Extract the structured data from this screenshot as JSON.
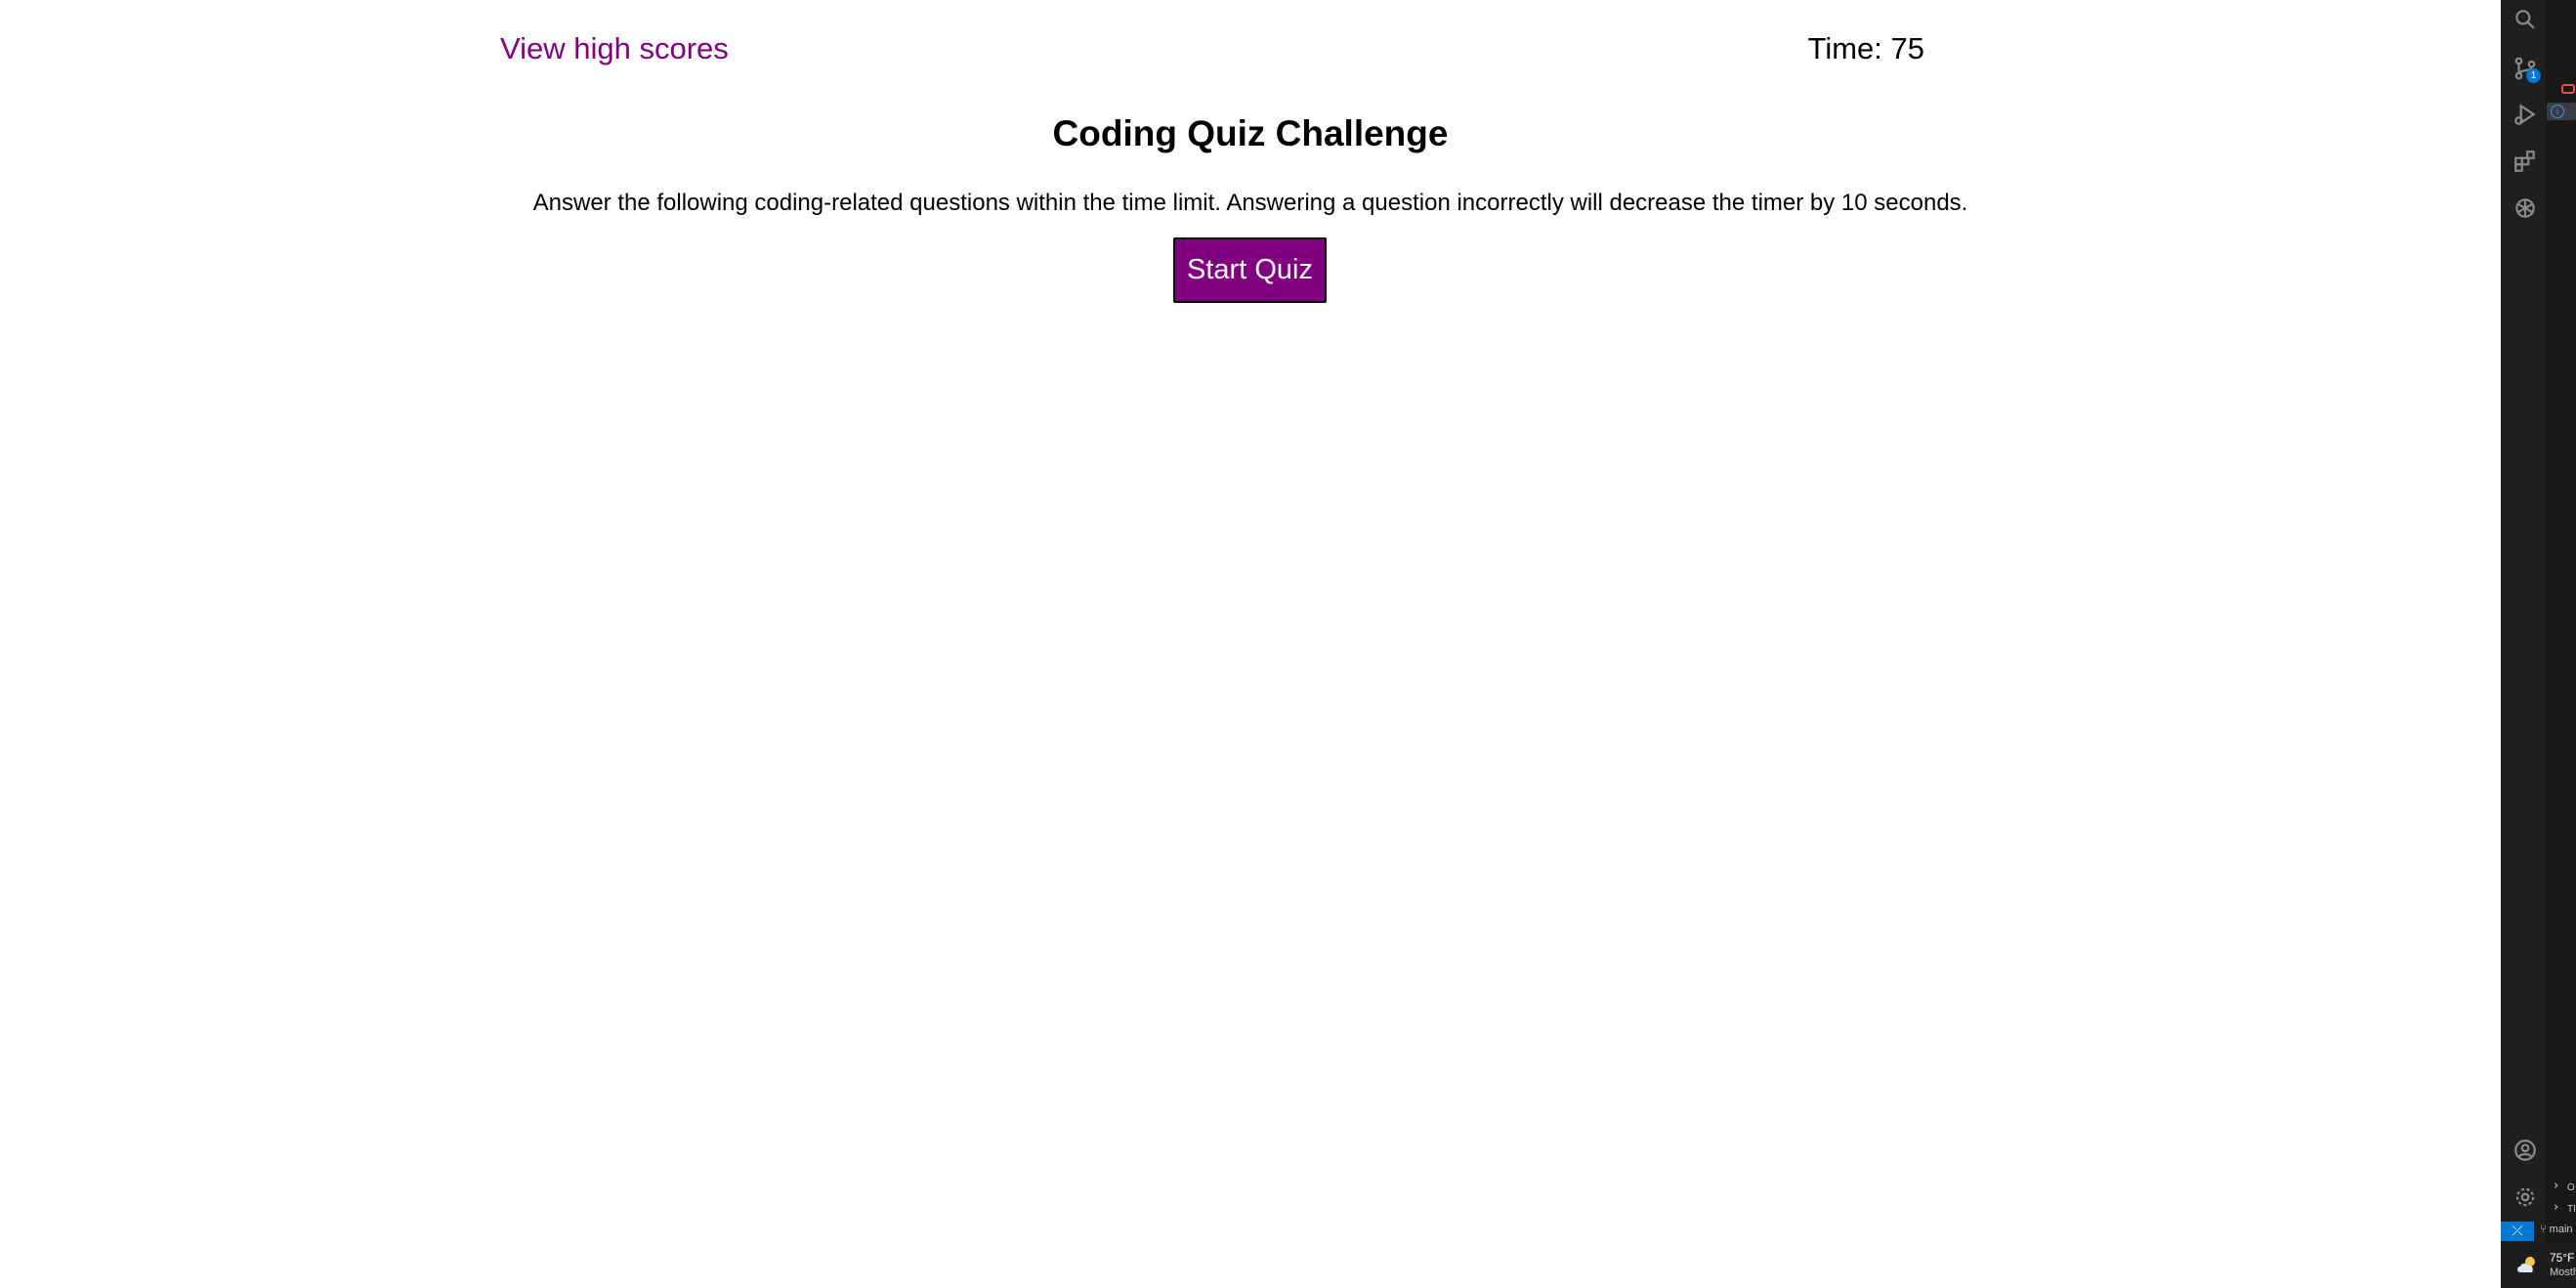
{
  "quiz": {
    "high_scores_link": "View high scores",
    "timer_text": "Time: 75",
    "title": "Coding Quiz Challenge",
    "description": "Answer the following coding-related questions within the time limit. Answering a question incorrectly will decrease the timer by 10 seconds.",
    "start_button": "Start Quiz"
  },
  "colors": {
    "accent": "#800080",
    "editor_bg": "#1f1f1f",
    "badge_blue": "#0078d4"
  },
  "activity_bar": {
    "icons": [
      "search-icon",
      "source-control-icon",
      "run-debug-icon",
      "extensions-icon",
      "chatgpt-icon",
      "account-icon",
      "settings-gear-icon"
    ],
    "scm_badge": "1",
    "chip_label": "i"
  },
  "side_panel": {
    "items": [
      {
        "chevron": "›",
        "label": "O"
      },
      {
        "chevron": "›",
        "label": "TI"
      }
    ],
    "branch": "main"
  },
  "status": {
    "remote_icon": "⤫"
  },
  "weather": {
    "temp": "75°F",
    "condition": "Mostly"
  }
}
